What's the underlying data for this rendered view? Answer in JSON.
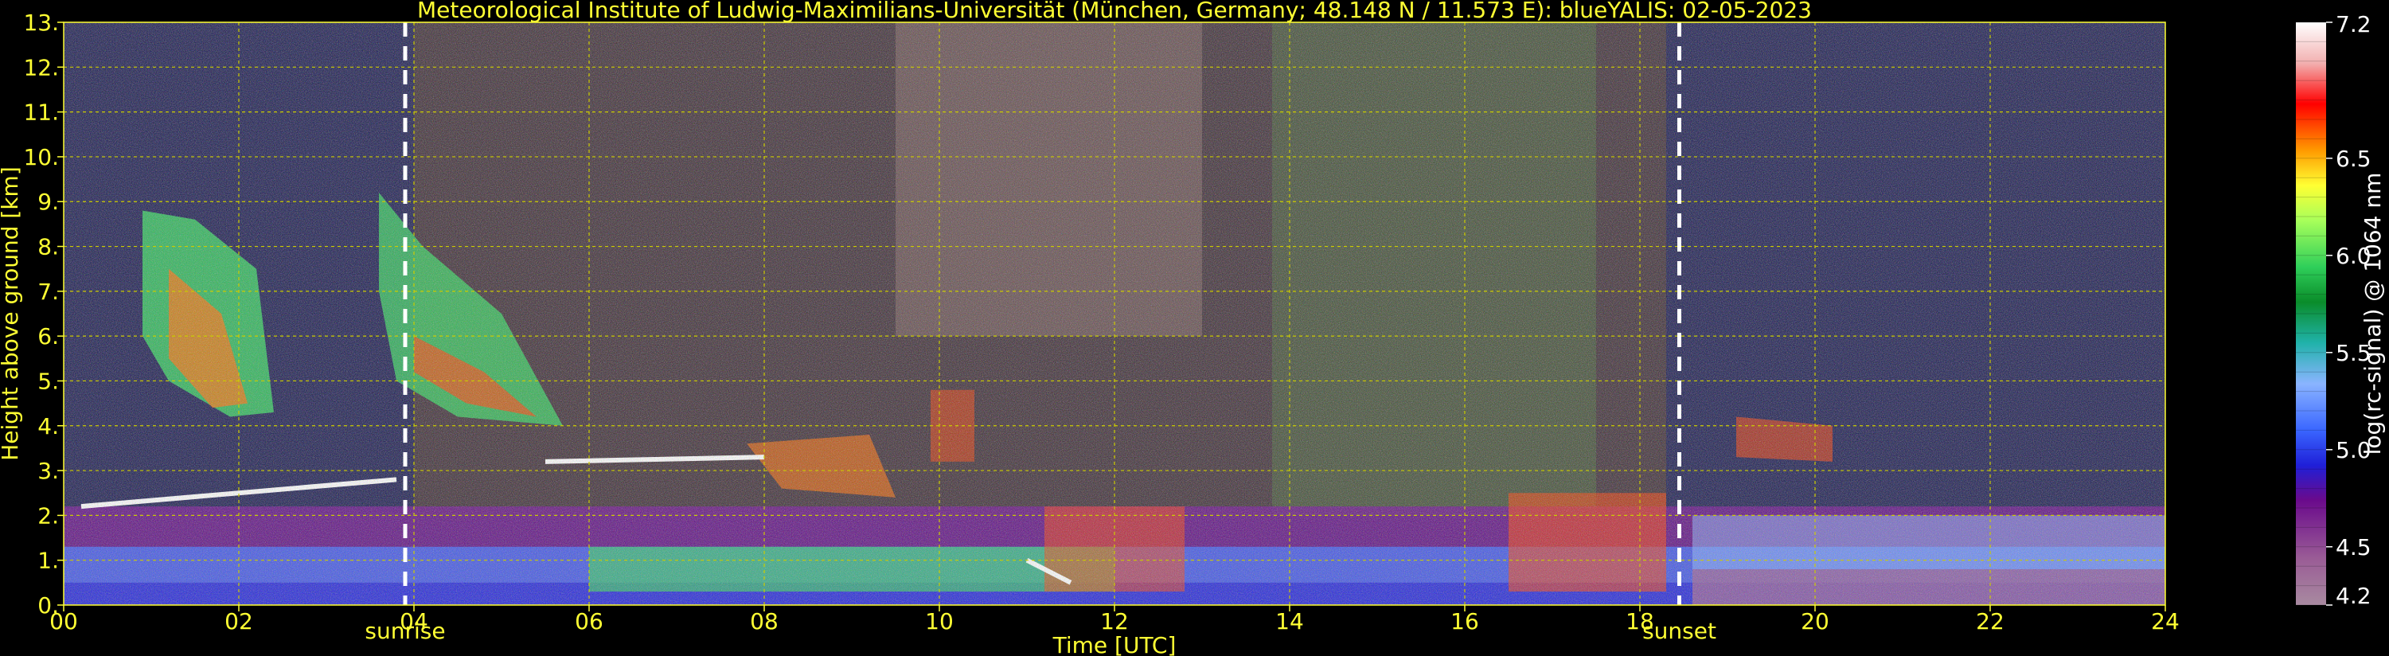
{
  "chart_data": {
    "type": "heatmap",
    "title": "Meteorological Institute of Ludwig-Maximilians-Universität (München, Germany; 48.148 N / 11.573 E):    blueYALIS: 02-05-2023",
    "xlabel": "Time [UTC]",
    "ylabel": "Height above ground [km]",
    "colorbar_label": "log(rc-signal) @ 1064 nm",
    "xlim": [
      0,
      24
    ],
    "ylim": [
      0,
      13
    ],
    "color_range": [
      4.2,
      7.2
    ],
    "x_ticks": [
      0,
      2,
      4,
      6,
      8,
      10,
      12,
      14,
      16,
      18,
      20,
      22,
      24
    ],
    "x_tick_labels": [
      "00",
      "02",
      "04",
      "06",
      "08",
      "10",
      "12",
      "14",
      "16",
      "18",
      "20",
      "22",
      "24"
    ],
    "y_ticks": [
      0,
      1,
      2,
      3,
      4,
      5,
      6,
      7,
      8,
      9,
      10,
      11,
      12,
      13
    ],
    "y_tick_labels": [
      "0.",
      "1.",
      "2.",
      "3.",
      "4.",
      "5.",
      "6.",
      "7.",
      "8.",
      "9.",
      "10.",
      "11.",
      "12.",
      "13."
    ],
    "colorbar_ticks": [
      4.2,
      4.5,
      5.0,
      5.5,
      6.0,
      6.5,
      7.2
    ],
    "colorbar_tick_labels": [
      "4.2",
      "4.5",
      "5.0",
      "5.5",
      "6.0",
      "6.5",
      "7.2"
    ],
    "grid": true,
    "markers": [
      {
        "label": "sunrise",
        "time": 3.9
      },
      {
        "label": "sunset",
        "time": 18.45
      }
    ],
    "colors": {
      "axis_text": "#ffff33",
      "grid": "#cccc00",
      "marker_line": "#ffffff",
      "background": "#000000"
    }
  }
}
